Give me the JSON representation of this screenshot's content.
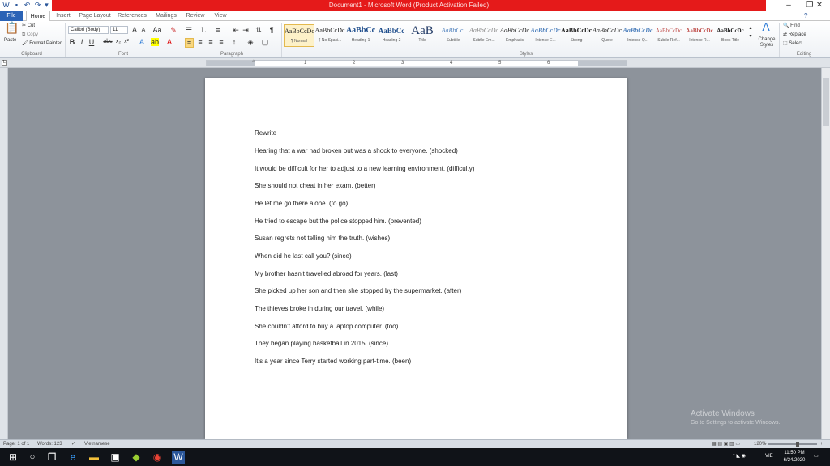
{
  "window": {
    "title": "Document1 - Microsoft Word (Product Activation Failed)"
  },
  "tabs": [
    {
      "label": "File"
    },
    {
      "label": "Home"
    },
    {
      "label": "Insert"
    },
    {
      "label": "Page Layout"
    },
    {
      "label": "References"
    },
    {
      "label": "Mailings"
    },
    {
      "label": "Review"
    },
    {
      "label": "View"
    }
  ],
  "ribbon": {
    "clipboard": {
      "paste": "Paste",
      "cut": "Cut",
      "copy": "Copy",
      "format_painter": "Format Painter",
      "label": "Clipboard"
    },
    "font": {
      "name": "Calibri (Body)",
      "size": "11",
      "label": "Font"
    },
    "paragraph": {
      "label": "Paragraph"
    },
    "styles": {
      "label": "Styles",
      "items": [
        {
          "preview": "AaBbCcDc",
          "name": "¶ Normal"
        },
        {
          "preview": "AaBbCcDc",
          "name": "¶ No Spaci..."
        },
        {
          "preview": "AaBbCc",
          "name": "Heading 1"
        },
        {
          "preview": "AaBbCc",
          "name": "Heading 2"
        },
        {
          "preview": "AaB",
          "name": "Title"
        },
        {
          "preview": "AaBbCc.",
          "name": "Subtitle"
        },
        {
          "preview": "AaBbCcDc",
          "name": "Subtle Em..."
        },
        {
          "preview": "AaBbCcDc",
          "name": "Emphasis"
        },
        {
          "preview": "AaBbCcDc",
          "name": "Intense E..."
        },
        {
          "preview": "AaBbCcDc",
          "name": "Strong"
        },
        {
          "preview": "AaBbCcDc",
          "name": "Quote"
        },
        {
          "preview": "AaBbCcDc",
          "name": "Intense Q..."
        },
        {
          "preview": "AaBbCcDc",
          "name": "Subtle Ref..."
        },
        {
          "preview": "AaBbCcDc",
          "name": "Intense R..."
        },
        {
          "preview": "AaBbCcDc",
          "name": "Book Title"
        }
      ],
      "change_styles": "Change Styles"
    },
    "editing": {
      "find": "Find",
      "replace": "Replace",
      "select": "Select",
      "label": "Editing"
    }
  },
  "document": {
    "lines": [
      "Rewrite",
      "Hearing that a war had broken out was a shock to everyone. (shocked)",
      "It would be difficult for her to adjust to a new learning environment. (difficulty)",
      "She should not cheat in her exam. (better)",
      "He let me go there alone. (to go)",
      "He tried to escape but the police stopped him. (prevented)",
      "Susan regrets not telling him the truth. (wishes)",
      "When did he last call you? (since)",
      "My brother hasn’t travelled abroad for years. (last)",
      "She picked up her son and then she stopped by the supermarket. (after)",
      "The thieves broke in during our travel. (while)",
      "She couldn’t afford to buy a laptop computer. (too)",
      "They began playing basketball in 2015. (since)",
      "It’s a year since Terry started working part-time. (been)"
    ]
  },
  "watermark": {
    "title": "Activate Windows",
    "subtitle": "Go to Settings to activate Windows."
  },
  "status": {
    "page": "Page: 1 of 1",
    "words": "Words: 123",
    "language": "Vietnamese",
    "zoom": "120%"
  },
  "taskbar": {
    "language": "VIE",
    "time": "11:50 PM",
    "date": "6/24/2020"
  }
}
